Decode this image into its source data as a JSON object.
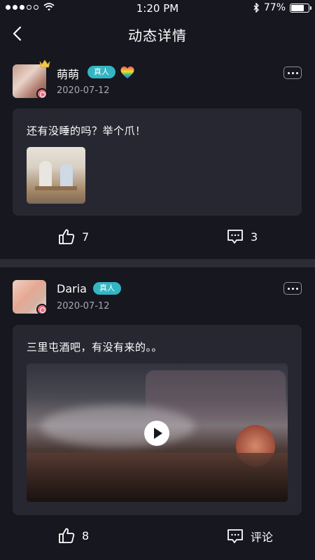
{
  "status_bar": {
    "time": "1:20 PM",
    "battery": "77%",
    "battery_level": 0.77,
    "icons": [
      "signal-dots-icon",
      "wifi-icon",
      "bluetooth-icon",
      "battery-icon"
    ]
  },
  "nav": {
    "title": "动态详情",
    "back_icon": "chevron-left-icon"
  },
  "posts": [
    {
      "username": "萌萌",
      "tag": "真人",
      "date": "2020-07-12",
      "text": "还有没睡的吗？举个爪！",
      "media": "photo",
      "likes": "7",
      "comments": "3",
      "icons": [
        "crown-icon",
        "rainbow-heart-icon",
        "more-icon",
        "thumbs-up-icon",
        "comment-icon"
      ]
    },
    {
      "username": "Daria",
      "tag": "真人",
      "date": "2020-07-12",
      "text": "三里屯酒吧，有没有来的。。",
      "media": "video",
      "likes": "8",
      "comments": "评论",
      "icons": [
        "more-icon",
        "play-icon",
        "thumbs-up-icon",
        "comment-icon"
      ]
    }
  ],
  "colors": {
    "background": "#16171f",
    "card": "#262731",
    "tag": "#33b5c4",
    "date_text": "#a6a8b3"
  }
}
